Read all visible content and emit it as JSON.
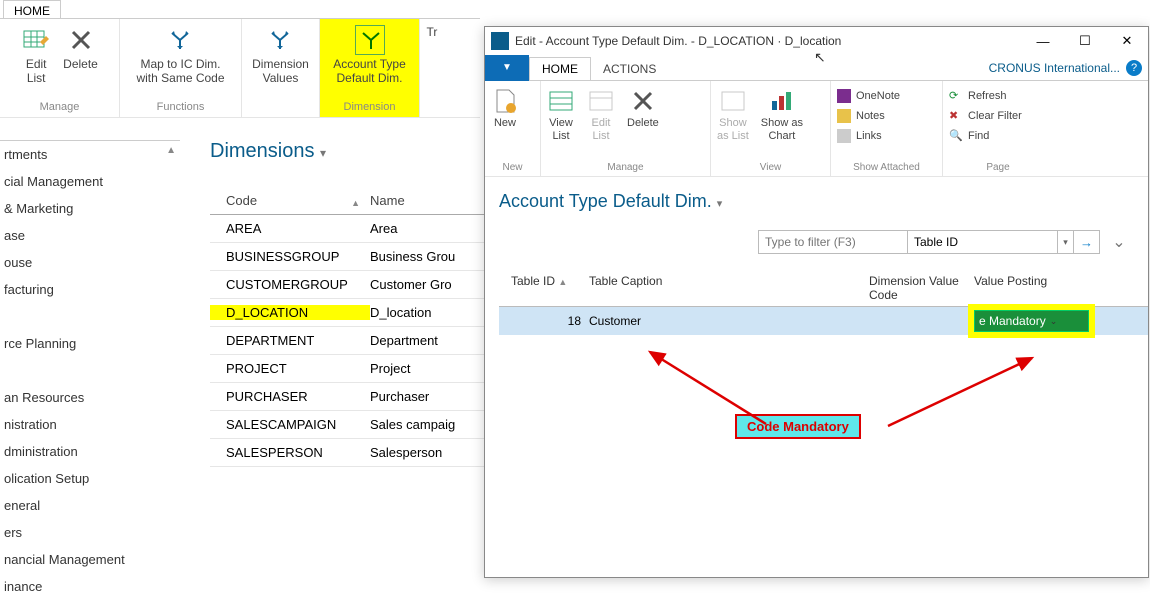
{
  "main_tab": "HOME",
  "main_ribbon": {
    "groups": [
      {
        "label": "Manage",
        "buttons": [
          {
            "l1": "Edit",
            "l2": "List"
          },
          {
            "l1": "Delete",
            "l2": ""
          }
        ]
      },
      {
        "label": "Functions",
        "buttons": [
          {
            "l1": "Map to IC Dim.",
            "l2": "with Same Code"
          }
        ]
      },
      {
        "label": "",
        "buttons": [
          {
            "l1": "Dimension",
            "l2": "Values"
          }
        ]
      },
      {
        "label": "Dimension",
        "highlight": true,
        "buttons": [
          {
            "l1": "Account Type",
            "l2": "Default Dim."
          }
        ]
      },
      {
        "label": "",
        "buttons": [
          {
            "l1": "Tr",
            "l2": ""
          }
        ]
      }
    ]
  },
  "nav": [
    "rtments",
    "cial Management",
    " & Marketing",
    "ase",
    "ouse",
    "facturing",
    "",
    "rce Planning",
    "",
    "an Resources",
    "nistration",
    "dministration",
    "olication Setup",
    "eneral",
    "ers",
    "nancial Management",
    "inance"
  ],
  "mid": {
    "title": "Dimensions",
    "headers": {
      "code": "Code",
      "name": "Name"
    },
    "rows": [
      {
        "code": "AREA",
        "name": "Area",
        "sel": false
      },
      {
        "code": "BUSINESSGROUP",
        "name": "Business Grou",
        "sel": false
      },
      {
        "code": "CUSTOMERGROUP",
        "name": "Customer Gro",
        "sel": false
      },
      {
        "code": "D_LOCATION",
        "name": "D_location",
        "sel": true
      },
      {
        "code": "DEPARTMENT",
        "name": "Department",
        "sel": false
      },
      {
        "code": "PROJECT",
        "name": "Project",
        "sel": false
      },
      {
        "code": "PURCHASER",
        "name": "Purchaser",
        "sel": false
      },
      {
        "code": "SALESCAMPAIGN",
        "name": "Sales campaig",
        "sel": false
      },
      {
        "code": "SALESPERSON",
        "name": "Salesperson",
        "sel": false
      }
    ]
  },
  "popup": {
    "title": "Edit - Account Type Default Dim. - D_LOCATION · D_location",
    "company": "CRONUS International...",
    "tabs": {
      "home": "HOME",
      "actions": "ACTIONS"
    },
    "ribbon": {
      "new_group": {
        "label": "New",
        "new": "New"
      },
      "manage_group": {
        "label": "Manage",
        "view_list": "View\nList",
        "edit_list": "Edit\nList",
        "delete": "Delete"
      },
      "view_group": {
        "label": "View",
        "show_list": "Show\nas List",
        "show_chart": "Show as\nChart"
      },
      "attached_group": {
        "label": "Show Attached",
        "onenote": "OneNote",
        "notes": "Notes",
        "links": "Links"
      },
      "page_group": {
        "label": "Page",
        "refresh": "Refresh",
        "clear_filter": "Clear Filter",
        "find": "Find"
      }
    },
    "body": {
      "title": "Account Type Default Dim.",
      "filter_placeholder": "Type to filter (F3)",
      "filter_field": "Table ID",
      "columns": {
        "table_id": "Table ID",
        "caption": "Table Caption",
        "dvc": "Dimension Value Code",
        "vp": "Value Posting"
      },
      "row": {
        "table_id": "18",
        "caption": "Customer",
        "dvc": "",
        "vp": "e Mandatory"
      }
    }
  },
  "annotation": "Code Mandatory"
}
